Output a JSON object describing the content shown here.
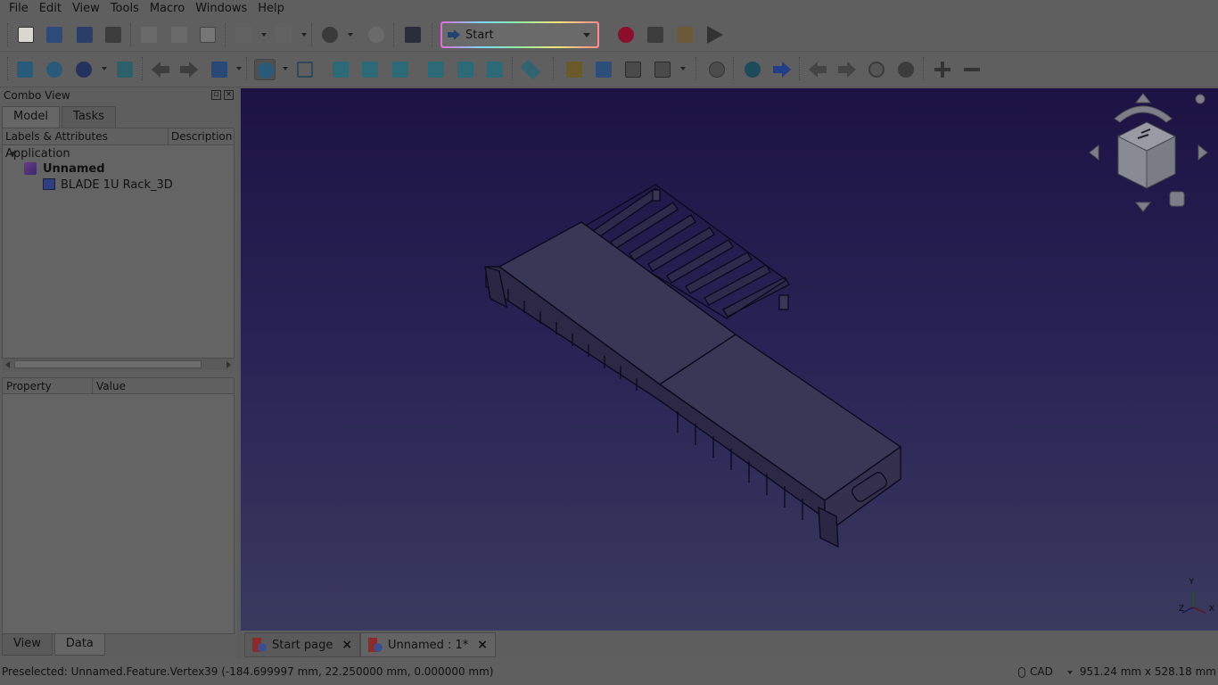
{
  "menu": [
    "File",
    "Edit",
    "View",
    "Tools",
    "Macro",
    "Windows",
    "Help"
  ],
  "menu_accel": [
    "F",
    "E",
    "V",
    "T",
    "M",
    "W",
    "H"
  ],
  "workbench": {
    "selected": "Start"
  },
  "combo": {
    "title": "Combo View",
    "tabs": [
      "Model",
      "Tasks"
    ],
    "tree_headers": [
      "Labels & Attributes",
      "Description"
    ],
    "tree": {
      "root": "Application",
      "doc": "Unnamed",
      "part": "BLADE 1U Rack_3D"
    },
    "prop_headers": [
      "Property",
      "Value"
    ],
    "bottom_tabs": [
      "View",
      "Data"
    ]
  },
  "doc_tabs": [
    "Start page",
    "Unnamed : 1*"
  ],
  "status": {
    "message": "Preselected: Unnamed.Feature.Vertex39 (-184.699997 mm, 22.250000 mm, 0.000000 mm)",
    "nav_style": "CAD",
    "dimensions": "951.24 mm x 528.18 mm"
  },
  "axis": {
    "x": "X",
    "y": "Y",
    "z": "Z"
  },
  "colors": {
    "bg_top": "#1c1344",
    "bg_bottom": "#3a3a5e",
    "record": "#8b0f2a",
    "nav_arrow": "#233e88"
  }
}
